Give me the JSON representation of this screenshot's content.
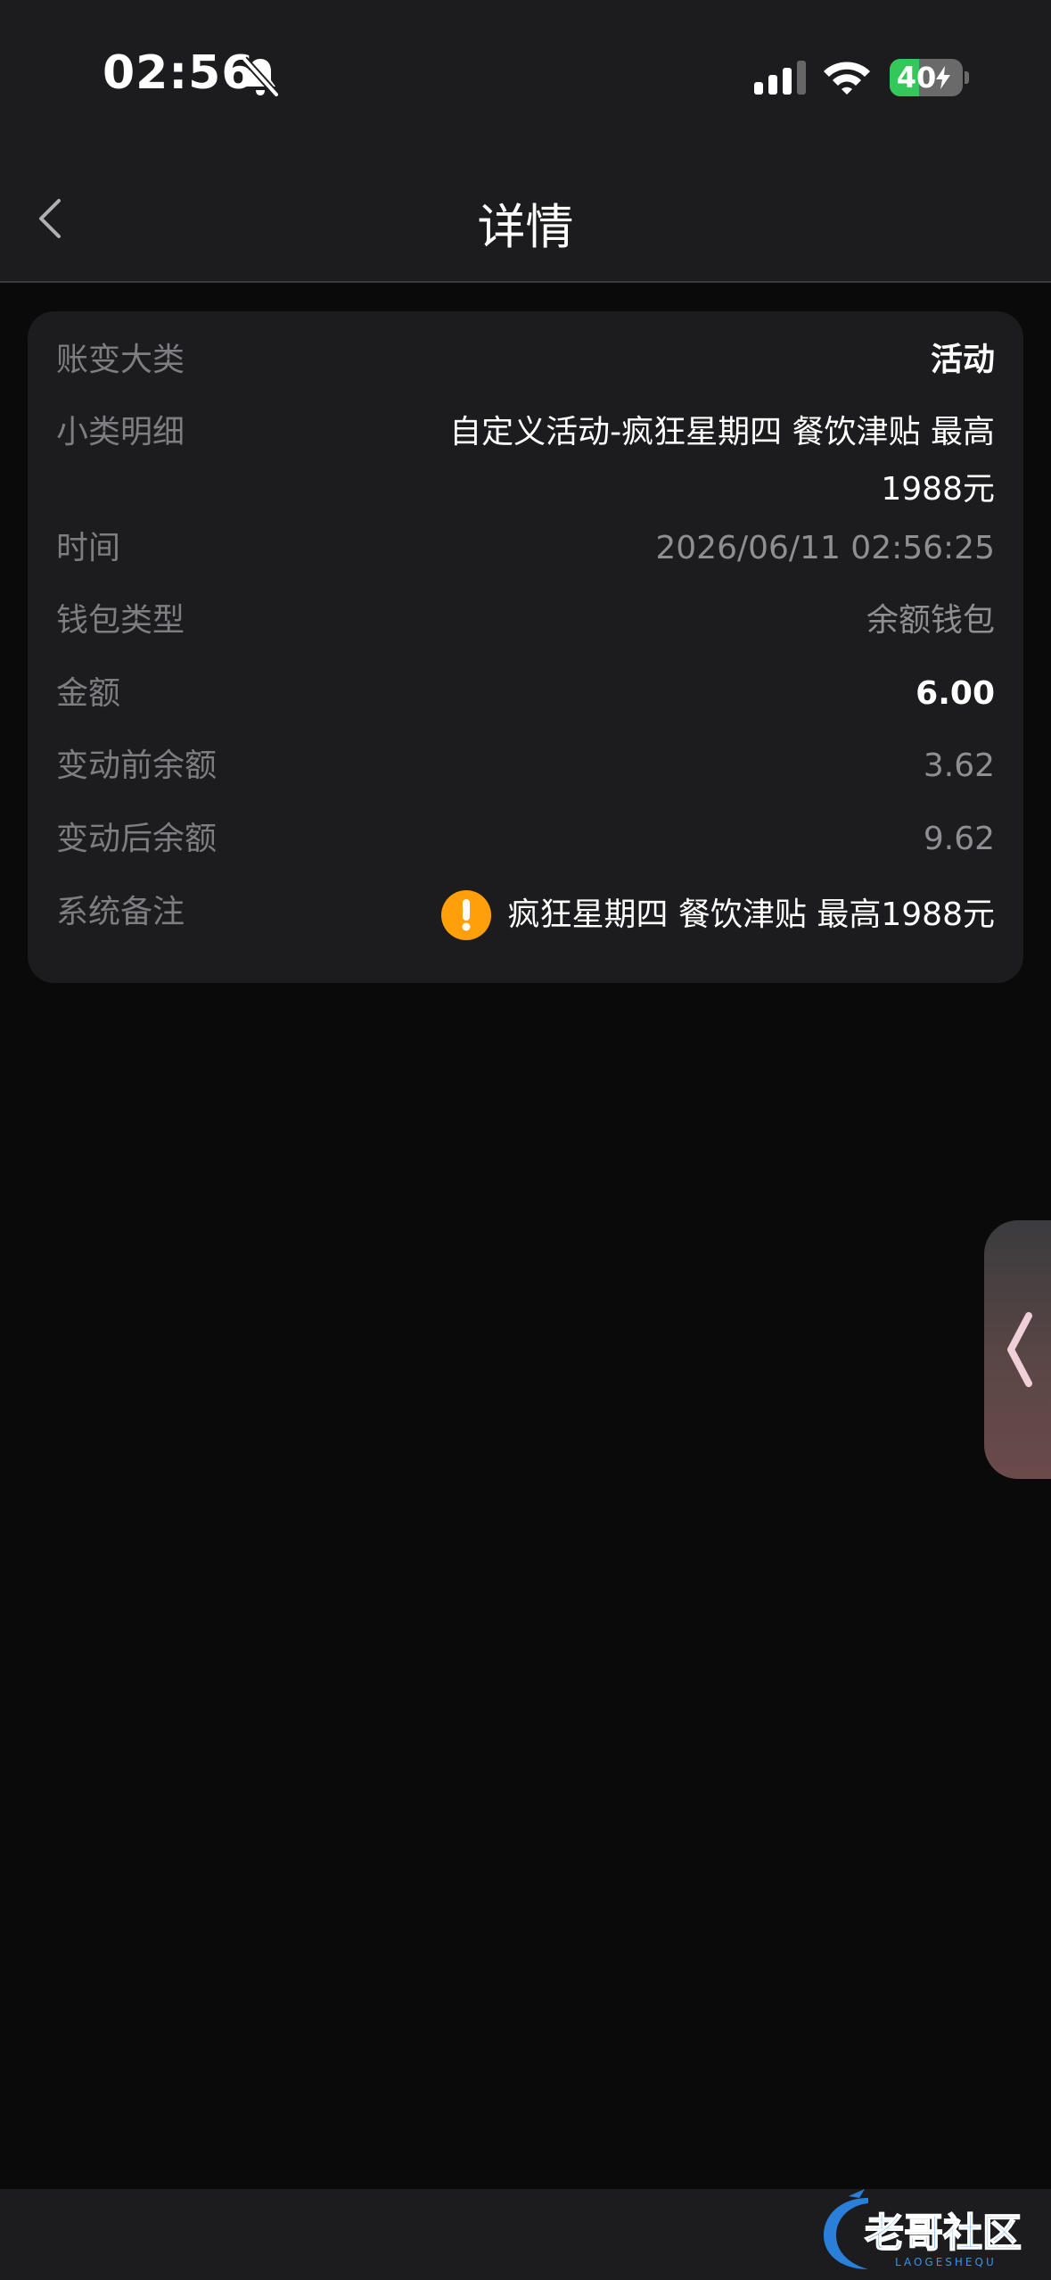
{
  "status_bar": {
    "time": "02:56",
    "battery_level": "40",
    "battery_fraction": 0.4
  },
  "nav": {
    "title": "详情",
    "back_icon": "chevron-left-icon"
  },
  "details": {
    "category": {
      "label": "账变大类",
      "value": "活动"
    },
    "subcategory": {
      "label": "小类明细",
      "value": "自定义活动-疯狂星期四 餐饮津贴 最高1988元"
    },
    "time": {
      "label": "时间",
      "value": "2026/06/11 02:56:25"
    },
    "wallet_type": {
      "label": "钱包类型",
      "value": "余额钱包"
    },
    "amount": {
      "label": "金额",
      "value": "6.00"
    },
    "balance_before": {
      "label": "变动前余额",
      "value": "3.62"
    },
    "balance_after": {
      "label": "变动后余额",
      "value": "9.62"
    },
    "system_remark": {
      "label": "系统备注",
      "value": "疯狂星期四 餐饮津贴 最高1988元",
      "icon": "warning-icon"
    }
  },
  "colors": {
    "background": "#0a0a0a",
    "card": "#1c1c1e",
    "label": "#7d7d82",
    "warning": "#ff9f0a",
    "battery": "#34c759"
  },
  "watermark": {
    "logo": "laoge-shequ-logo",
    "text_cn": "老哥社区",
    "text_en": "LAOGESHEQU"
  }
}
